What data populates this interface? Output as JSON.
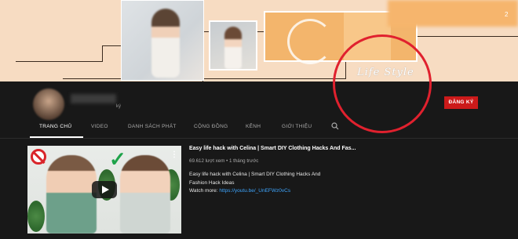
{
  "banner": {
    "overlay_text": "Life Style",
    "topright_text": "2"
  },
  "channel": {
    "subscribers_suffix": "ký",
    "subscribe_label": "ĐĂNG KÝ"
  },
  "tabs": [
    {
      "label": "TRANG CHỦ",
      "active": true
    },
    {
      "label": "VIDEO",
      "active": false
    },
    {
      "label": "DANH SÁCH PHÁT",
      "active": false
    },
    {
      "label": "CỘNG ĐỒNG",
      "active": false
    },
    {
      "label": "KÊNH",
      "active": false
    },
    {
      "label": "GIỚI THIỆU",
      "active": false
    }
  ],
  "search_icon": "search-icon",
  "video": {
    "title": "Easy life hack with Celina | Smart DIY Clothing Hacks And Fas...",
    "views": "69.612 lượt xem",
    "separator": " • ",
    "age": "1 tháng trước",
    "description_line1": "Easy life hack with Celina | Smart DIY Clothing Hacks And",
    "description_line2": "Fashion Hack Ideas",
    "watch_more_label": "Watch more: ",
    "watch_more_link": "https://youtu.be/_UnEFWz0vCs"
  },
  "colors": {
    "accent_red": "#cc1a1a",
    "annotation_circle": "#e0212e",
    "link_blue": "#3ea6ff"
  }
}
